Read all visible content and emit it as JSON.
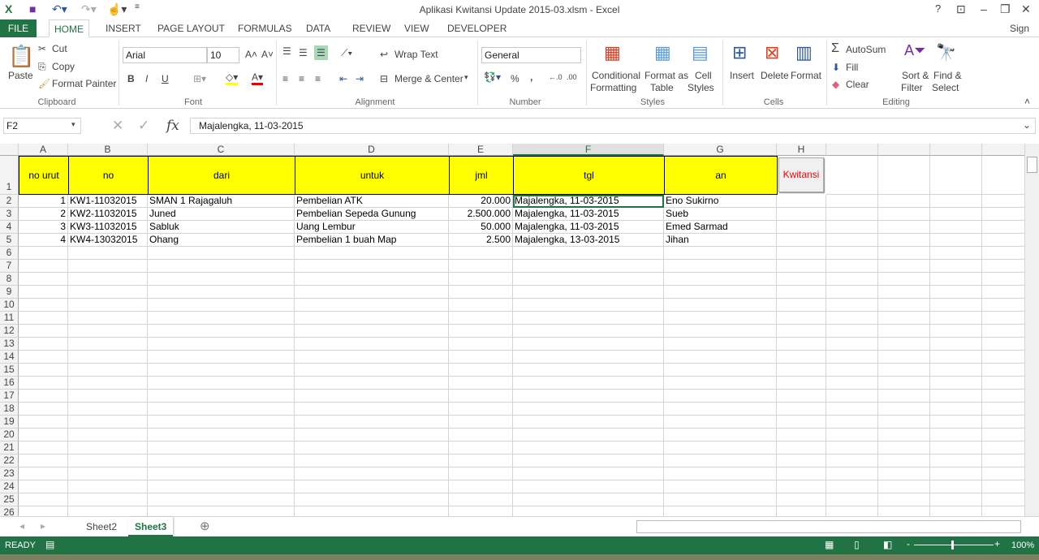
{
  "window": {
    "title": "Aplikasi Kwitansi Update 2015-03.xlsm - Excel",
    "help": "?",
    "sign_in": "Sign in"
  },
  "tabs": [
    "FILE",
    "HOME",
    "INSERT",
    "PAGE LAYOUT",
    "FORMULAS",
    "DATA",
    "REVIEW",
    "VIEW",
    "DEVELOPER"
  ],
  "ribbon": {
    "clipboard": {
      "paste": "Paste",
      "cut": "Cut",
      "copy": "Copy",
      "format_painter": "Format Painter",
      "group": "Clipboard"
    },
    "font": {
      "name": "Arial",
      "size": "10",
      "bold": "B",
      "italic": "I",
      "underline": "U",
      "group": "Font"
    },
    "alignment": {
      "wrap_text": "Wrap Text",
      "merge_center": "Merge & Center",
      "group": "Alignment"
    },
    "number": {
      "format": "General",
      "percent": "%",
      "comma": ",",
      "group": "Number"
    },
    "styles": {
      "conditional": "Conditional",
      "conditional2": "Formatting",
      "format_as": "Format as",
      "format_as2": "Table",
      "cell": "Cell",
      "cell2": "Styles",
      "group": "Styles"
    },
    "cells": {
      "insert": "Insert",
      "delete": "Delete",
      "format": "Format",
      "group": "Cells"
    },
    "editing": {
      "autosum": "AutoSum",
      "fill": "Fill",
      "clear": "Clear",
      "sort": "Sort &",
      "sort2": "Filter",
      "find": "Find &",
      "find2": "Select",
      "group": "Editing"
    }
  },
  "formula_bar": {
    "name_box": "F2",
    "fx": "fx",
    "value": "Majalengka, 11-03-2015"
  },
  "columns": [
    "A",
    "B",
    "C",
    "D",
    "E",
    "F",
    "G",
    "H"
  ],
  "selected_column": "F",
  "header_row": [
    "no urut",
    "no",
    "dari",
    "untuk",
    "jml",
    "tgl",
    "an"
  ],
  "kwitansi_button": "Kwitansi",
  "rows": [
    [
      "1",
      "KW1-11032015",
      "SMAN 1 Rajagaluh",
      "Pembelian ATK",
      "20.000",
      "Majalengka, 11-03-2015",
      "Eno Sukirno"
    ],
    [
      "2",
      "KW2-11032015",
      "Juned",
      "Pembelian Sepeda Gunung",
      "2.500.000",
      "Majalengka, 11-03-2015",
      "Sueb"
    ],
    [
      "3",
      "KW3-11032015",
      "Sabluk",
      "Uang Lembur",
      "50.000",
      "Majalengka, 11-03-2015",
      "Emed Sarmad"
    ],
    [
      "4",
      "KW4-13032015",
      "Ohang",
      "Pembelian 1 buah Map",
      "2.500",
      "Majalengka, 13-03-2015",
      "Jihan"
    ]
  ],
  "row_count": 26,
  "sheets": [
    "Sheet2",
    "Sheet3"
  ],
  "active_sheet": "Sheet3",
  "status": {
    "ready": "READY",
    "zoom": "100%"
  },
  "colors": {
    "accent": "#217346",
    "header_fill": "#ffff00",
    "kwitansi_text": "#ff0000"
  }
}
